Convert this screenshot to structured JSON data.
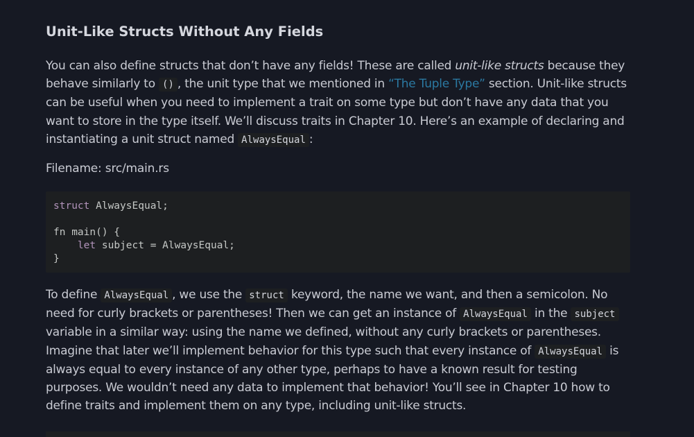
{
  "section": {
    "heading": "Unit-Like Structs Without Any Fields"
  },
  "paragraph1": {
    "t1": "You can also define structs that don’t have any fields! These are called ",
    "em1": "unit-like structs",
    "t2": " because they behave similarly to ",
    "code1": "()",
    "t3": ", the unit type that we mentioned in ",
    "link1": "“The Tuple Type”",
    "t4": " section. Unit-like structs can be useful when you need to implement a trait on some type but don’t have any data that you want to store in the type itself. We’ll discuss traits in Chapter 10. Here’s an example of declaring and instantiating a unit struct named ",
    "code2": "AlwaysEqual",
    "t5": ":"
  },
  "filename": "Filename: src/main.rs",
  "code_block": {
    "line1_kw": "struct",
    "line1_rest": " AlwaysEqual;",
    "line3": "fn main() {",
    "line4_indent": "    ",
    "line4_kw": "let",
    "line4_rest": " subject = AlwaysEqual;",
    "line5": "}"
  },
  "paragraph2": {
    "t1": "To define ",
    "code1": "AlwaysEqual",
    "t2": ", we use the ",
    "code2": "struct",
    "t3": " keyword, the name we want, and then a semicolon. No need for curly brackets or parentheses! Then we can get an instance of ",
    "code3": "AlwaysEqual",
    "t4": " in the ",
    "code4": "subject",
    "t5": " variable in a similar way: using the name we defined, without any curly brackets or parentheses. Imagine that later we’ll implement behavior for this type such that every instance of ",
    "code5": "AlwaysEqual",
    "t6": " is always equal to every instance of any other type, perhaps to have a known result for testing purposes. We wouldn’t need any data to implement that behavior! You’ll see in Chapter 10 how to define traits and implement them on any type, including unit-like structs."
  }
}
